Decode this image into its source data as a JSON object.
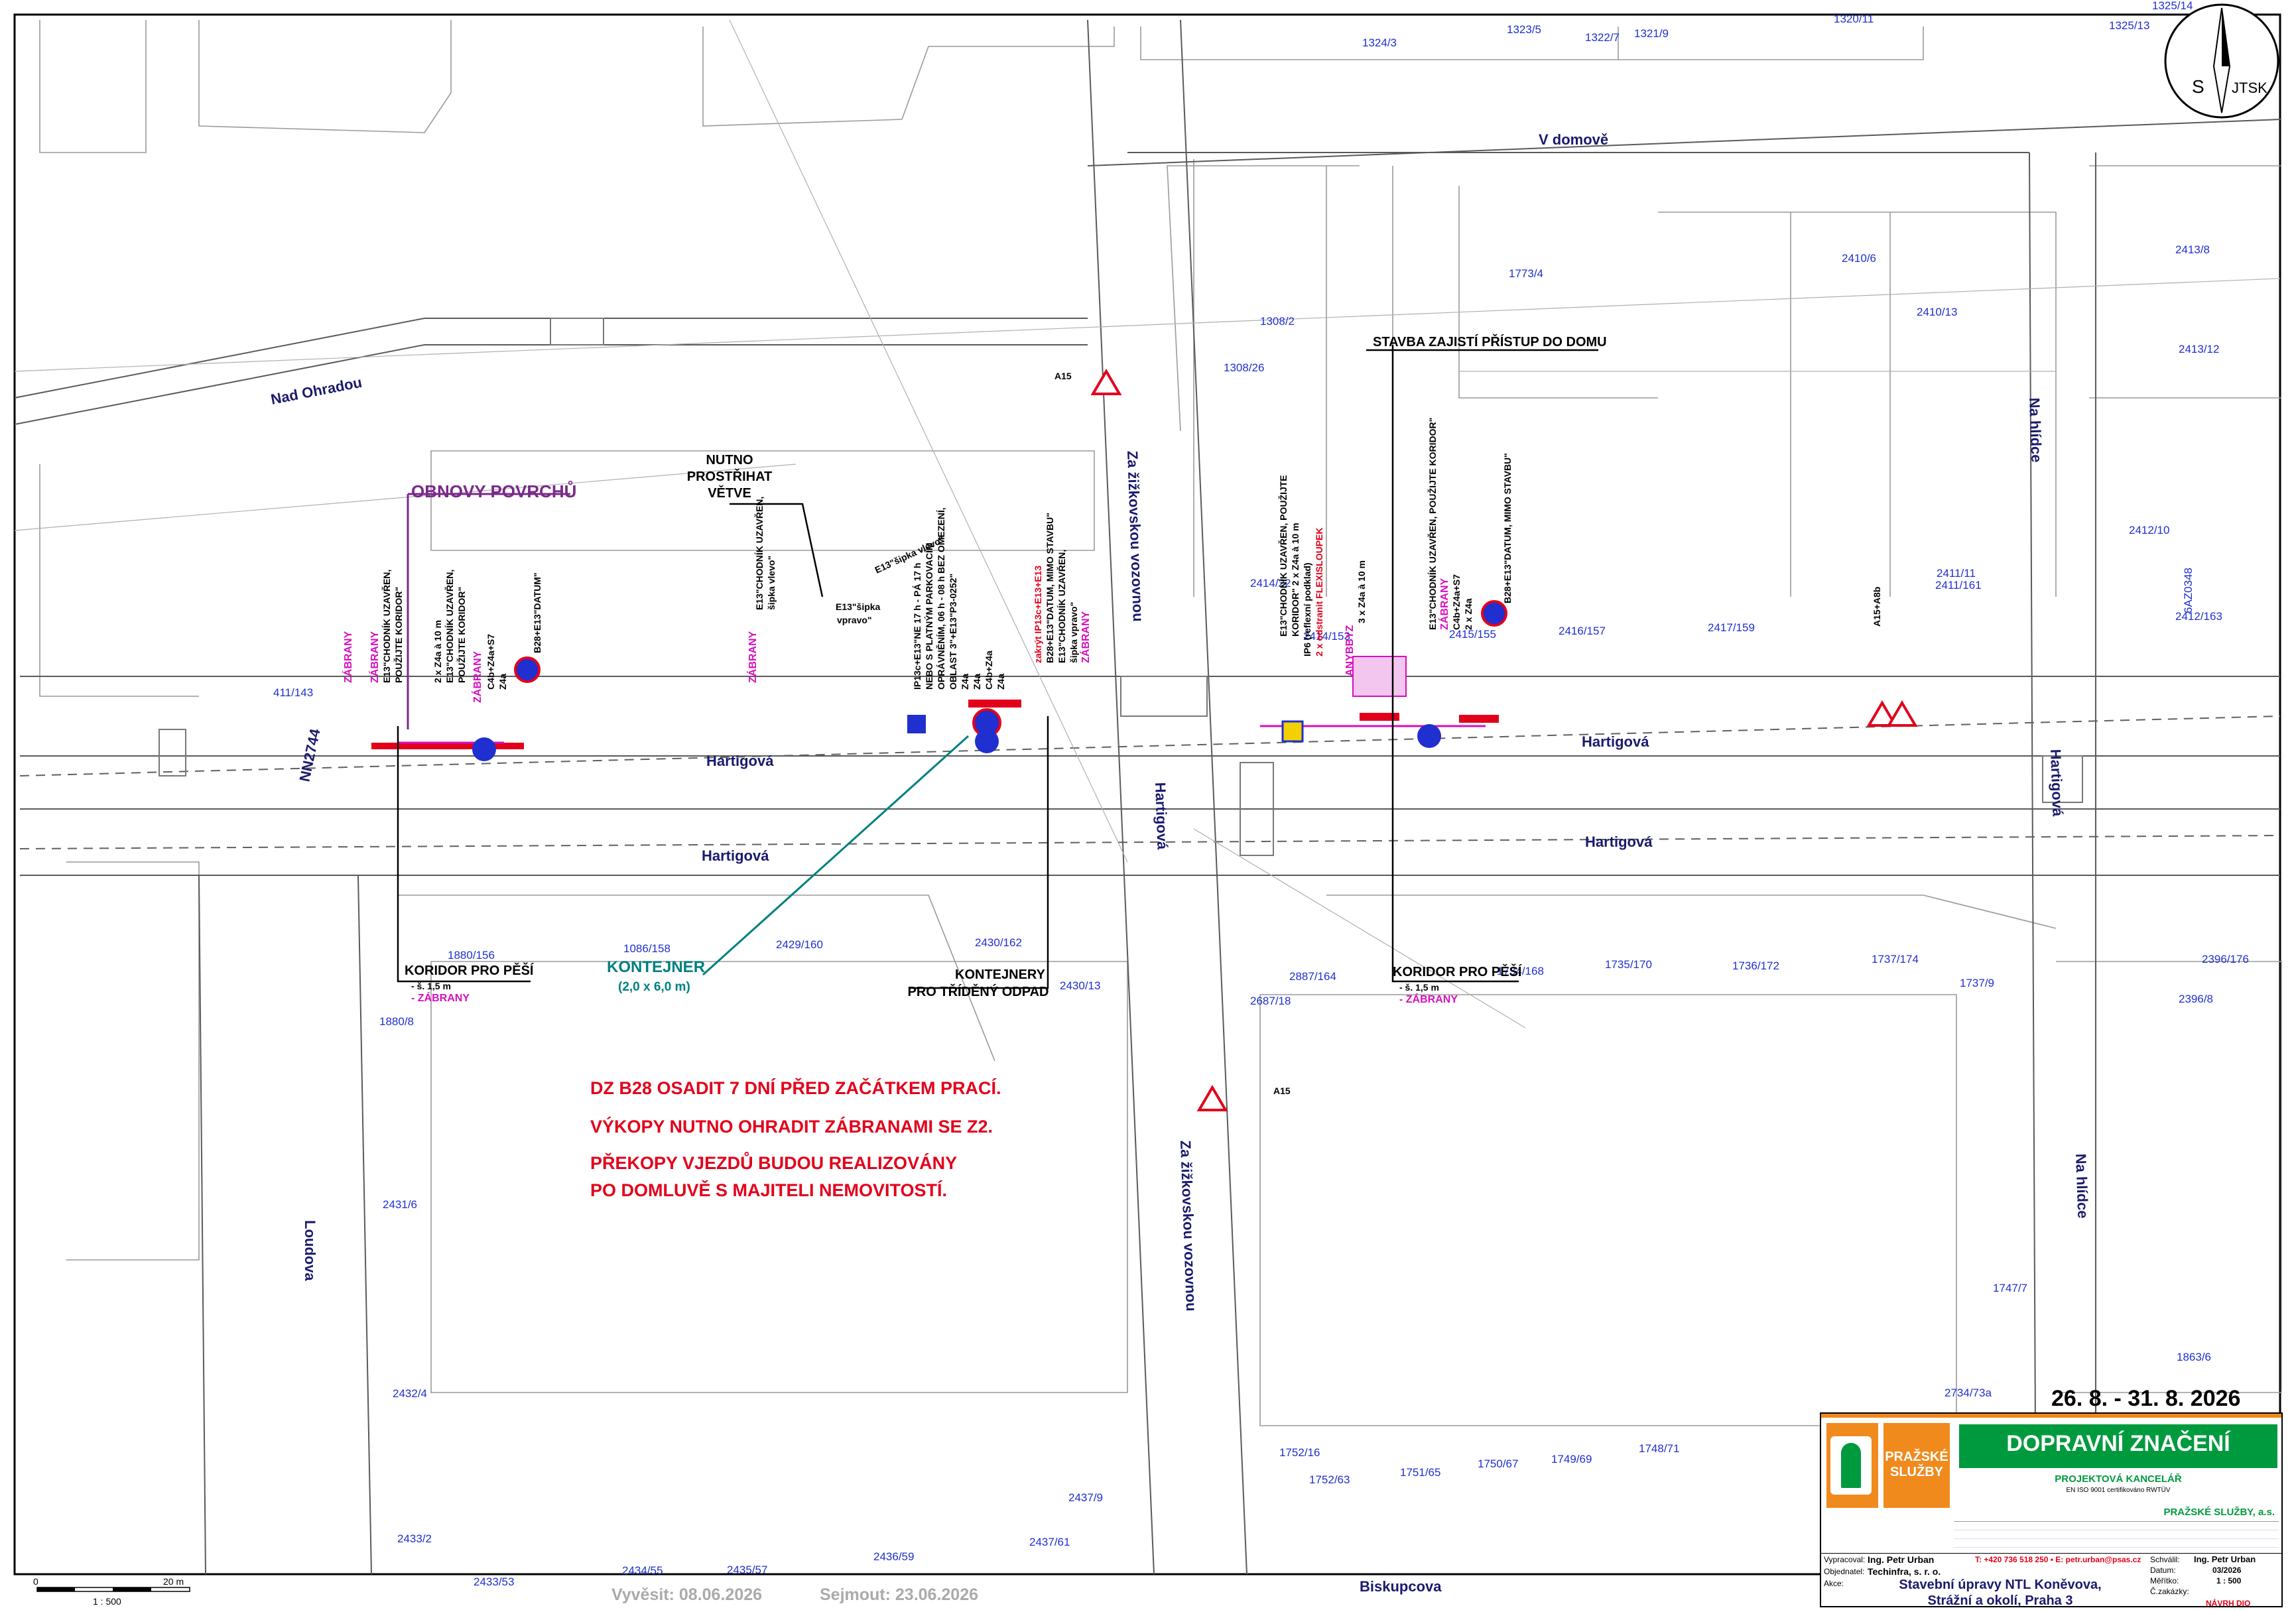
{
  "north": {
    "s": "S",
    "system": "JTSK"
  },
  "streets": {
    "v_domove": "V domově",
    "nad_ohradou": "Nad Ohradou",
    "za_zizkovskou_top": "Za žižkovskou vozovnou",
    "za_zizkovskou_bottom": "Za žižkovskou vozovnou",
    "hartigova_1": "Hartigová",
    "hartigova_2": "Hartigová",
    "hartigova_3": "Hartigová",
    "hartigova_4": "Hartigová",
    "hartigova_v1": "Hartigová",
    "hartigova_v2": "Hartigová",
    "na_hlidce_1": "Na hlídce",
    "na_hlidce_2": "Na hlídce",
    "loudova": "Loudova",
    "riskuncova": "Biskupcova",
    "nn": "NN2744"
  },
  "parcels": [
    "1325/14",
    "1325/13",
    "1320/11",
    "1323/5",
    "1322/7",
    "1321/9",
    "1324/3",
    "1773/4",
    "2410/6",
    "2413/8",
    "2410/13",
    "1308/2",
    "1308/26",
    "2413/12",
    "2412/10",
    "2411/11",
    "2411/161",
    "2414/22",
    "2414/153",
    "2415/155",
    "2416/157",
    "2417/159",
    "2412/163",
    "6AZ0348",
    "411/143",
    "1880/156",
    "1880/8",
    "1086/158",
    "2429/160",
    "2430/162",
    "2430/13",
    "2887/164",
    "2687/18",
    "1734/168",
    "1735/170",
    "1736/172",
    "1737/174",
    "2396/176",
    "1737/9",
    "2396/8",
    "1747/7",
    "1863/6",
    "2734/73a",
    "2431/6",
    "2432/4",
    "2433/2",
    "2433/53",
    "2434/55",
    "2435/57",
    "2436/59",
    "2437/61",
    "2437/9",
    "1752/16",
    "1752/63",
    "1751/65",
    "1750/67",
    "1749/69",
    "1748/71"
  ],
  "callouts": {
    "obnovy": "OBNOVY POVRCHŮ",
    "nutno": [
      "NUTNO",
      "PROSTŘIHAT",
      "VĚTVE"
    ],
    "stavba": "STAVBA ZAJISTÍ PŘÍSTUP DO DOMU",
    "koridor_left": "KORIDOR PRO PĚŠÍ",
    "koridor_left_w": "- š. 1,5 m",
    "koridor_left_z": "- ZÁBRANY",
    "koridor_right": "KORIDOR PRO PĚŠÍ",
    "koridor_right_w": "- š. 1,5 m",
    "koridor_right_z": "- ZÁBRANY",
    "kontejner": "KONTEJNER",
    "kontejner_size": "(2,0 x 6,0 m)",
    "kontejnery": [
      "KONTEJNERY",
      "PRO TŘÍDĚNÝ ODPAD"
    ],
    "a15_top": "A15",
    "a15_bottom": "A15",
    "a15_right": "A15+A8b"
  },
  "sign_notes": {
    "e13_left": [
      "2 x Z4a à 10 m",
      "E13\"CHODNÍK UZAVŘEN,",
      "POUŽIJTE KORIDOR\""
    ],
    "chodnik_left": [
      "E13\"CHODNÍK UZAVŘEN,",
      "POUŽIJTE KORIDOR\""
    ],
    "c4b": [
      "C4b+Z4a+S7",
      "Z4a"
    ],
    "b28_left": "B28+E13\"DATUM\"",
    "zabrany": "ZÁBRANY",
    "e13_sipka_vlevo": "E13\"šipka vlevo\"",
    "e13_sipka_vpravo": [
      "E13\"šipka",
      "vpravo\""
    ],
    "chodnik_mid": [
      "E13\"CHODNÍK UZAVŘEN,",
      "šipka vlevo\""
    ],
    "ip13": [
      "IP13c+E13\"NE 17 h - PÁ 17 h",
      "NEBO S PLATNÝM PARKOVACÍM",
      "OPRÁVNĚNÍM, 06 h - 08 h BEZ OMEZENÍ,",
      "OBLAST 3\"+E13\"P3-0252\"",
      "Z4a",
      "Z4a",
      "C4b+Z4a",
      "Z4a"
    ],
    "zakryt": [
      "zakrýt IP13c+E13+E13",
      "B28+E13\"DATUM, MIMO STAVBU\"",
      "E13\"CHODNÍK UZAVŘEN,",
      "šipka vpravo\""
    ],
    "e13_mid_right": [
      "E13\"CHODNÍK UZAVŘEN, POUŽIJTE",
      "KORIDOR\" 2 x Z4a à 10 m"
    ],
    "ip6": [
      "IP6 (reflexní podklad)",
      "2 x odstranit FLEXISLOUPEK"
    ],
    "anybbyz": "ANYBBYZ",
    "z4a_10": "3 x Z4a à 10 m",
    "e13_right": [
      "E13\"CHODNÍK UZAVŘEN, POUŽIJTE KORIDOR\"",
      "ZÁBRANY",
      "C4b+Z4a+S7",
      "2 x Z4a"
    ],
    "b28_right": "B28+E13\"DATUM, MIMO STAVBU\""
  },
  "notes": [
    "DZ B28 OSADIT 7 DNÍ PŘED ZAČÁTKEM PRACÍ.",
    "VÝKOPY NUTNO OHRADIT ZÁBRANAMI SE Z2.",
    "PŘEKOPY VJEZDŮ BUDOU REALIZOVÁNY",
    "PO DOMLUVĚ S MAJITELI NEMOVITOSTÍ."
  ],
  "dates": {
    "range": "26. 8. - 31. 8. 2026",
    "vyvesit": "Vyvěsit: 08.06.2026",
    "sejmout": "Sejmout: 23.06.2026"
  },
  "scale": {
    "zero": "0",
    "twenty": "20 m",
    "ratio": "1 : 500"
  },
  "title_block": {
    "logo": [
      "PRAŽSKÉ",
      "SLUŽBY"
    ],
    "heading": "DOPRAVNÍ ZNAČENÍ",
    "sub": "PROJEKTOVÁ KANCELÁŘ",
    "iso": "EN ISO 9001 certifikováno RWTÜV",
    "company": "PRAŽSKÉ SLUŽBY, a.s.",
    "vypracoval_lbl": "Vypracoval:",
    "vypracoval": "Ing. Petr Urban",
    "phone": "T: +420 736 518 250 • E: petr.urban@psas.cz",
    "objednatel_lbl": "Objednatel:",
    "objednatel": "Techinfra, s. r. o.",
    "akce_lbl": "Akce:",
    "akce": [
      "Stavební úpravy NTL Koněvova,",
      "Strážní a okolí, Praha 3"
    ],
    "schvalil_lbl": "Schválil:",
    "schvalil": "Ing. Petr Urban",
    "datum_lbl": "Datum:",
    "datum": "03/2026",
    "meritko_lbl": "Měřítko:",
    "meritko": "1 : 500",
    "zakazka_lbl": "Č.zakázky:",
    "navrh": "NÁVRH DIO"
  },
  "colors": {
    "red": "#e3001b",
    "magenta": "#d60fbf",
    "teal": "#008080",
    "blue": "#1f2fd0",
    "green": "#009a3e",
    "orange": "#f08a1c"
  }
}
